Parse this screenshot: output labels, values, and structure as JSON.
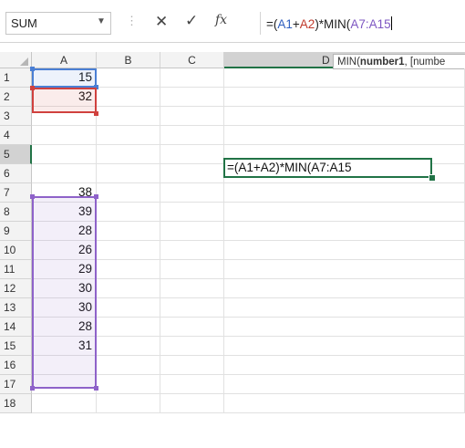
{
  "formula_bar": {
    "name_box": "SUM",
    "separator": "⋮",
    "cancel_icon": "✕",
    "enter_icon": "✓",
    "fx_label": "fx",
    "formula_prefix": "=(",
    "ref1": "A1",
    "plus": "+",
    "ref2": "A2",
    "middle": ")*MIN(",
    "ref3": "A7:A15"
  },
  "tooltip": {
    "fn": "MIN(",
    "arg_bold": "number1",
    "rest": ", [numbe"
  },
  "columns": [
    "A",
    "B",
    "C",
    "D"
  ],
  "rows": [
    "1",
    "2",
    "3",
    "4",
    "5",
    "6",
    "7",
    "8",
    "9",
    "10",
    "11",
    "12",
    "13",
    "14",
    "15",
    "16",
    "17",
    "18"
  ],
  "cells_a": [
    "15",
    "32",
    "",
    "",
    "",
    "",
    "38",
    "39",
    "28",
    "26",
    "29",
    "30",
    "30",
    "28",
    "31",
    "",
    "",
    ""
  ],
  "edit_cell_text": "=(A1+A2)*MIN(A7:A15",
  "colors": {
    "blue_ref": "#2f5fbf",
    "red_ref": "#c0392b",
    "purple_ref": "#7e57c2",
    "excel_green": "#217346"
  }
}
